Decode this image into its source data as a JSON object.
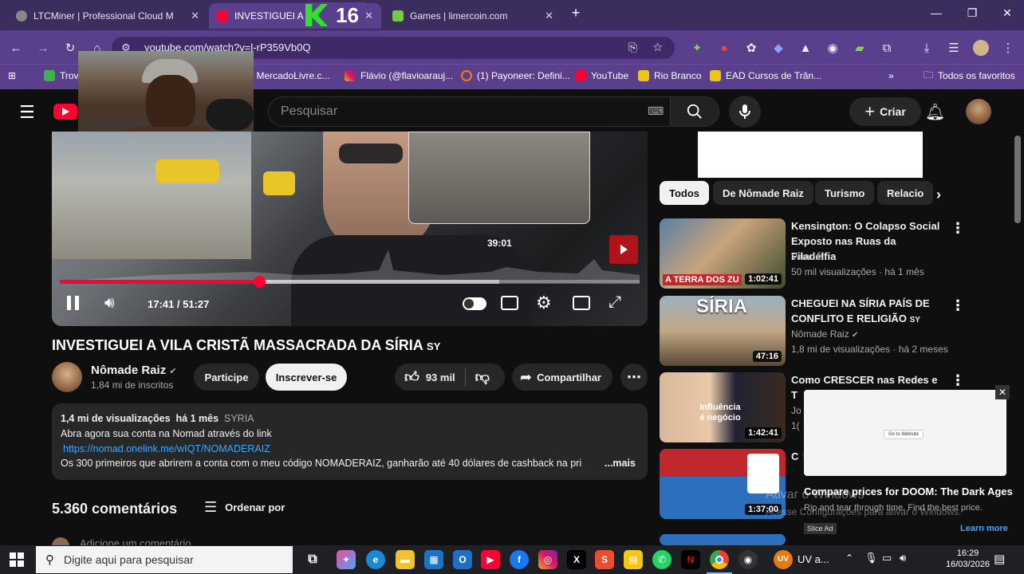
{
  "browser": {
    "tabs": [
      {
        "title": "LTCMiner | Professional Cloud M",
        "active": false
      },
      {
        "title": "INVESTIGUEI A VILA CRIST",
        "active": true
      },
      {
        "title": "Games | limercoin.com",
        "active": false
      }
    ],
    "overlay_badge": "16",
    "url": "youtube.com/watch?v=l-rP359Vb0Q",
    "bookmarks": [
      "Trov",
      "| MercadoLivre.c...",
      "Flávio (@flavioarauj...",
      "(1) Payoneer: Defini...",
      "YouTube",
      "Rio Branco",
      "EAD Cursos de Trân..."
    ],
    "all_bookmarks": "Todos os favoritos"
  },
  "youtube": {
    "search_placeholder": "Pesquisar",
    "create_label": "Criar"
  },
  "player": {
    "time_current": "17:41",
    "time_total": "51:27",
    "time_separator": "/",
    "preview_time": "39:01",
    "progress_fraction": 0.344,
    "hover_fraction": 0.758
  },
  "video": {
    "title": "INVESTIGUEI A VILA CRISTÃ MASSACRADA DA SÍRIA",
    "title_suffix": "SY",
    "channel": "Nômade Raiz",
    "subscribers": "1,84 mi de inscritos",
    "join_label": "Participe",
    "subscribe_label": "Inscrever-se",
    "likes": "93 mil",
    "share_label": "Compartilhar"
  },
  "description": {
    "views": "1,4 mi de visualizações",
    "age": "há 1 mês",
    "tag": "SYRIA",
    "line1": "Abra agora sua conta na Nomad através do link",
    "link": "https://nomad.onelink.me/wIQT/NOMADERAIZ",
    "line3": "Os 300 primeiros que abrirem a conta com o meu código NOMADERAIZ, ganharão até 40 dólares de cashback na pri",
    "more": "...mais"
  },
  "comments": {
    "count": "5.360 comentários",
    "sort_label": "Ordenar por",
    "add_placeholder": "Adicione um comentário..."
  },
  "chips": [
    "Todos",
    "De Nômade Raiz",
    "Turismo",
    "Relacio"
  ],
  "related": [
    {
      "title": "Kensington: O Colapso Social Exposto nas Ruas da Filadélfia",
      "channel": "Vamos!",
      "meta": "50 mil visualizações · há 1 mês",
      "duration": "1:02:41",
      "thumb_text": "A TERRA DOS ZU"
    },
    {
      "title": "CHEGUEI NA SÍRIA PAÍS DE CONFLITO E RELIGIÃO",
      "title_suffix": "SY",
      "channel": "Nômade Raiz",
      "meta": "1,8 mi de visualizações · há 2 meses",
      "duration": "47:16",
      "thumb_text": "SÍRIA"
    },
    {
      "title": "Como CRESCER nas Redes e T",
      "channel": "Jo",
      "meta": "1(",
      "duration": "1:42:41",
      "thumb_text": "Influência é negócio"
    },
    {
      "title": "C V",
      "channel": "",
      "meta": "",
      "duration": "1:37:00",
      "thumb_text": ""
    }
  ],
  "ad": {
    "title": "Compare prices for DOOM: The Dark Ages",
    "subtitle": "Rip and tear through time. Find the best price.",
    "go_label": "Go to Website",
    "learn_more": "Learn more",
    "slice_label": "Slice Ad",
    "windows_line1": "Ativar o Windows",
    "windows_line2": "Acesse Configurações para ativar o Windows."
  },
  "taskbar": {
    "search_placeholder": "Digite aqui para pesquisar",
    "time": "16:29",
    "date": "16/03/2026",
    "weather": "UV a..."
  },
  "colors": {
    "accent_red": "#ff0033",
    "chrome_purple": "#5a3f8c",
    "yt_bg": "#0f0f0f"
  }
}
